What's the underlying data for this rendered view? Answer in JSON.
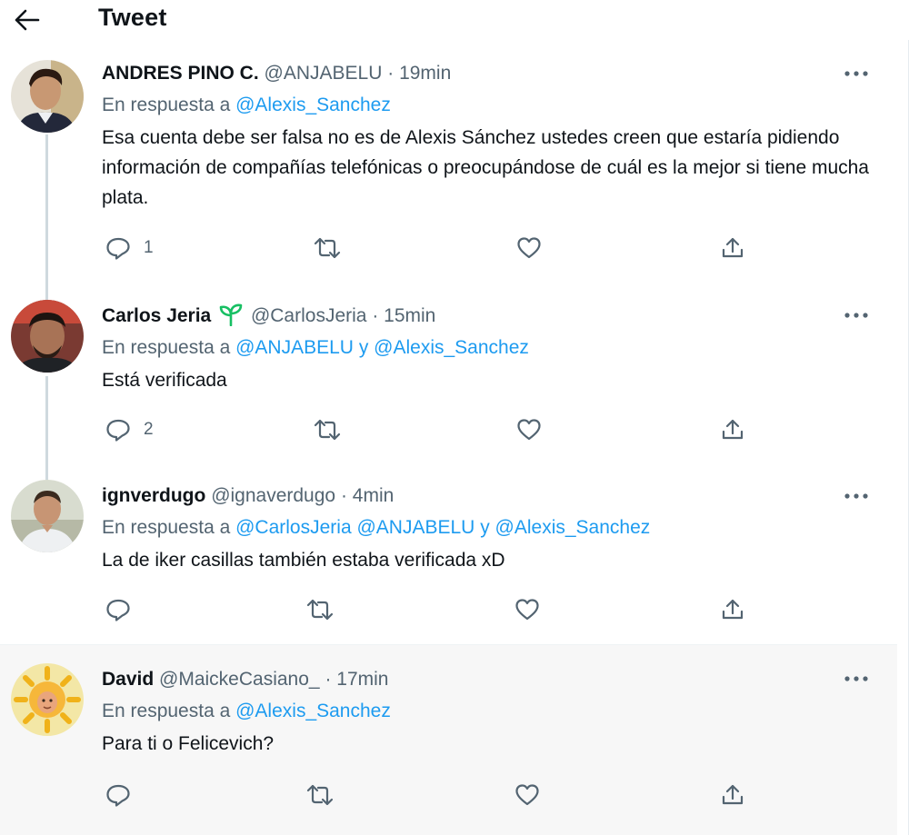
{
  "header": {
    "title": "Tweet",
    "back_icon": "arrow-left-icon"
  },
  "labels": {
    "replying_to": "En respuesta a",
    "and": "y",
    "separator": "·"
  },
  "colors": {
    "link": "#1d9bf0",
    "secondary": "#536471",
    "sprout": "#17bf63",
    "shaded_bg": "#f7f7f7"
  },
  "tweets": [
    {
      "name": "ANDRES PINO C.",
      "handle": "@ANJABELU",
      "time": "19min",
      "mentions": [
        "@Alexis_Sanchez"
      ],
      "text": "Esa cuenta debe ser falsa no es de Alexis Sánchez ustedes creen que estaría pidiendo información de compañías telefónicas o preocupándose de cuál es la mejor si tiene mucha plata.",
      "reply_count": "1"
    },
    {
      "name": "Carlos Jeria",
      "badge_icon": "sprout-icon",
      "handle": "@CarlosJeria",
      "time": "15min",
      "mentions": [
        "@ANJABELU",
        "@Alexis_Sanchez"
      ],
      "text": "Está verificada",
      "reply_count": "2"
    },
    {
      "name": "ignverdugo",
      "handle": "@ignaverdugo",
      "time": "4min",
      "mentions": [
        "@CarlosJeria",
        "@ANJABELU",
        "@Alexis_Sanchez"
      ],
      "text": "La de iker casillas también estaba verificada xD",
      "reply_count": ""
    },
    {
      "name": "David",
      "handle": "@MaickeCasiano_",
      "time": "17min",
      "mentions": [
        "@Alexis_Sanchez"
      ],
      "text": "Para ti o Felicevich?",
      "reply_count": ""
    }
  ]
}
